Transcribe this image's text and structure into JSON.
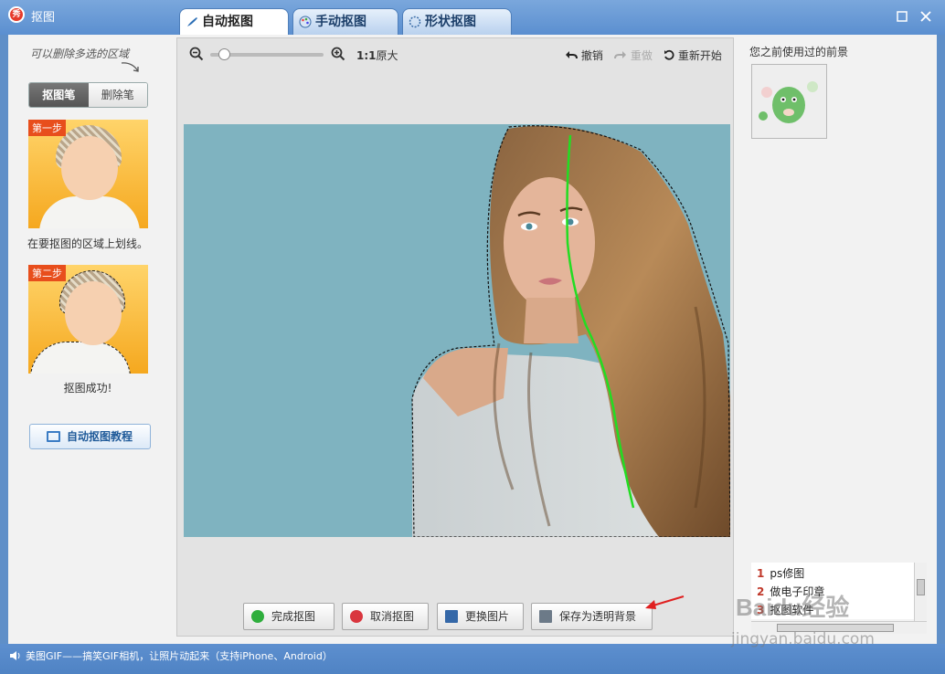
{
  "window": {
    "title": "抠图",
    "app_icon_text": "秀"
  },
  "tabs": [
    {
      "label": "自动抠图",
      "active": true,
      "icon": "brush-icon"
    },
    {
      "label": "手动抠图",
      "active": false,
      "icon": "palette-icon"
    },
    {
      "label": "形状抠图",
      "active": false,
      "icon": "shape-icon"
    }
  ],
  "left_panel": {
    "handwritten_hint": "可以删除多选的区域",
    "pen_tabs": [
      "抠图笔",
      "删除笔"
    ],
    "step1": {
      "badge": "第一步",
      "caption": "在要抠图的区域上划线。"
    },
    "step2": {
      "badge": "第二步",
      "caption": "抠图成功!"
    },
    "tutorial_button": "自动抠图教程"
  },
  "toolbar": {
    "zoom_ratio": "1:1",
    "original_size": "原大",
    "undo": "撤销",
    "redo": "重做",
    "restart": "重新开始",
    "zoom_level": 0.08
  },
  "bottom_buttons": {
    "finish": "完成抠图",
    "cancel": "取消抠图",
    "replace": "更换图片",
    "save_transparent": "保存为透明背景"
  },
  "right_panel": {
    "title": "您之前使用过的前景",
    "recent": [
      {
        "num": "1",
        "label": "ps修图"
      },
      {
        "num": "2",
        "label": "做电子印章"
      },
      {
        "num": "3",
        "label": "抠图软件"
      }
    ]
  },
  "status": {
    "text": "美图GIF——搞笑GIF相机，让照片动起来（支持iPhone、Android）"
  },
  "watermark": {
    "brand": "Baidu经验",
    "url": "jingyan.baidu.com"
  },
  "colors": {
    "accent_blue": "#5b8fd0",
    "canvas_bg": "#7fb3c0",
    "stroke_green": "#22dd22",
    "step_badge": "#e84e1c"
  }
}
